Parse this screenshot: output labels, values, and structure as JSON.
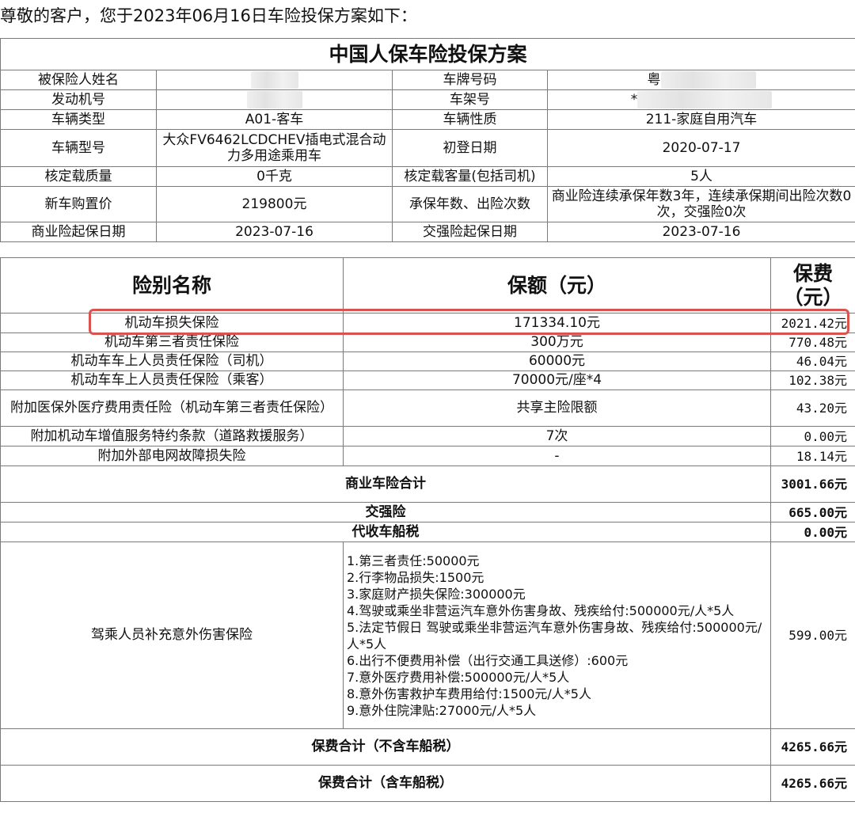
{
  "greeting": "尊敬的客户，您于2023年06月16日车险投保方案如下：",
  "plan_title": "中国人保车险投保方案",
  "info": {
    "insured_name_label": "被保险人姓名",
    "plate_label": "车牌号码",
    "plate_value": "粤",
    "engine_label": "发动机号",
    "vin_label": "车架号",
    "vin_value": "*",
    "vehicle_type_label": "车辆类型",
    "vehicle_type_value": "A01-客车",
    "vehicle_nature_label": "车辆性质",
    "vehicle_nature_value": "211-家庭自用汽车",
    "model_label": "车辆型号",
    "model_value": "大众FV6462LCDCHEV插电式混合动力多用途乘用车",
    "first_reg_label": "初登日期",
    "first_reg_value": "2020-07-17",
    "load_mass_label": "核定载质量",
    "load_mass_value": "0千克",
    "capacity_label": "核定载客量(包括司机)",
    "capacity_value": "5人",
    "price_label": "新车购置价",
    "price_value": "219800元",
    "years_label": "承保年数、出险次数",
    "years_value": "商业险连续承保年数3年，连续承保期间出险次数0次，交强险0次",
    "commercial_start_label": "商业险起保日期",
    "commercial_start_value": "2023-07-16",
    "compulsory_start_label": "交强险起保日期",
    "compulsory_start_value": "2023-07-16"
  },
  "coverage_header": {
    "name": "险别名称",
    "amount": "保额（元）",
    "fee_line1": "保费",
    "fee_line2": "（元）"
  },
  "coverages": [
    {
      "name": "机动车损失保险",
      "amount": "171334.10元",
      "fee": "2021.42元"
    },
    {
      "name": "机动车第三者责任保险",
      "amount": "300万元",
      "fee": "770.48元"
    },
    {
      "name": "机动车车上人员责任保险（司机）",
      "amount": "60000元",
      "fee": "46.04元"
    },
    {
      "name": "机动车车上人员责任保险（乘客）",
      "amount": "70000元/座*4",
      "fee": "102.38元"
    },
    {
      "name": "附加医保外医疗费用责任险（机动车第三者责任保险）",
      "amount": "共享主险限额",
      "fee": "43.20元"
    },
    {
      "name": "附加机动车增值服务特约条款（道路救援服务）",
      "amount": "7次",
      "fee": "0.00元"
    },
    {
      "name": "附加外部电网故障损失险",
      "amount": "-",
      "fee": "18.14元"
    }
  ],
  "commercial_total": {
    "label": "商业车险合计",
    "value": "3001.66元"
  },
  "compulsory": {
    "label": "交强险",
    "value": "665.00元"
  },
  "vessel_tax": {
    "label": "代收车船税",
    "value": "0.00元"
  },
  "accident": {
    "name": "驾乘人员补充意外伤害保险",
    "items": [
      "1.第三者责任:50000元",
      "2.行李物品损失:1500元",
      "3.家庭财产损失保险:300000元",
      "4.驾驶或乘坐非营运汽车意外伤害身故、残疾给付:500000元/人*5人",
      "5.法定节假日 驾驶或乘坐非营运汽车意外伤害身故、残疾给付:500000元/人*5人",
      "6.出行不便费用补偿（出行交通工具送修）:600元",
      "7.意外医疗费用补偿:500000元/人*5人",
      "8.意外伤害救护车费用给付:1500元/人*5人",
      "9.意外住院津贴:27000元/人*5人"
    ],
    "fee": "599.00元"
  },
  "total_excl_tax": {
    "label": "保费合计（不含车船税）",
    "value": "4265.66元"
  },
  "total_incl_tax": {
    "label": "保费合计（含车船税）",
    "value": "4265.66元"
  }
}
